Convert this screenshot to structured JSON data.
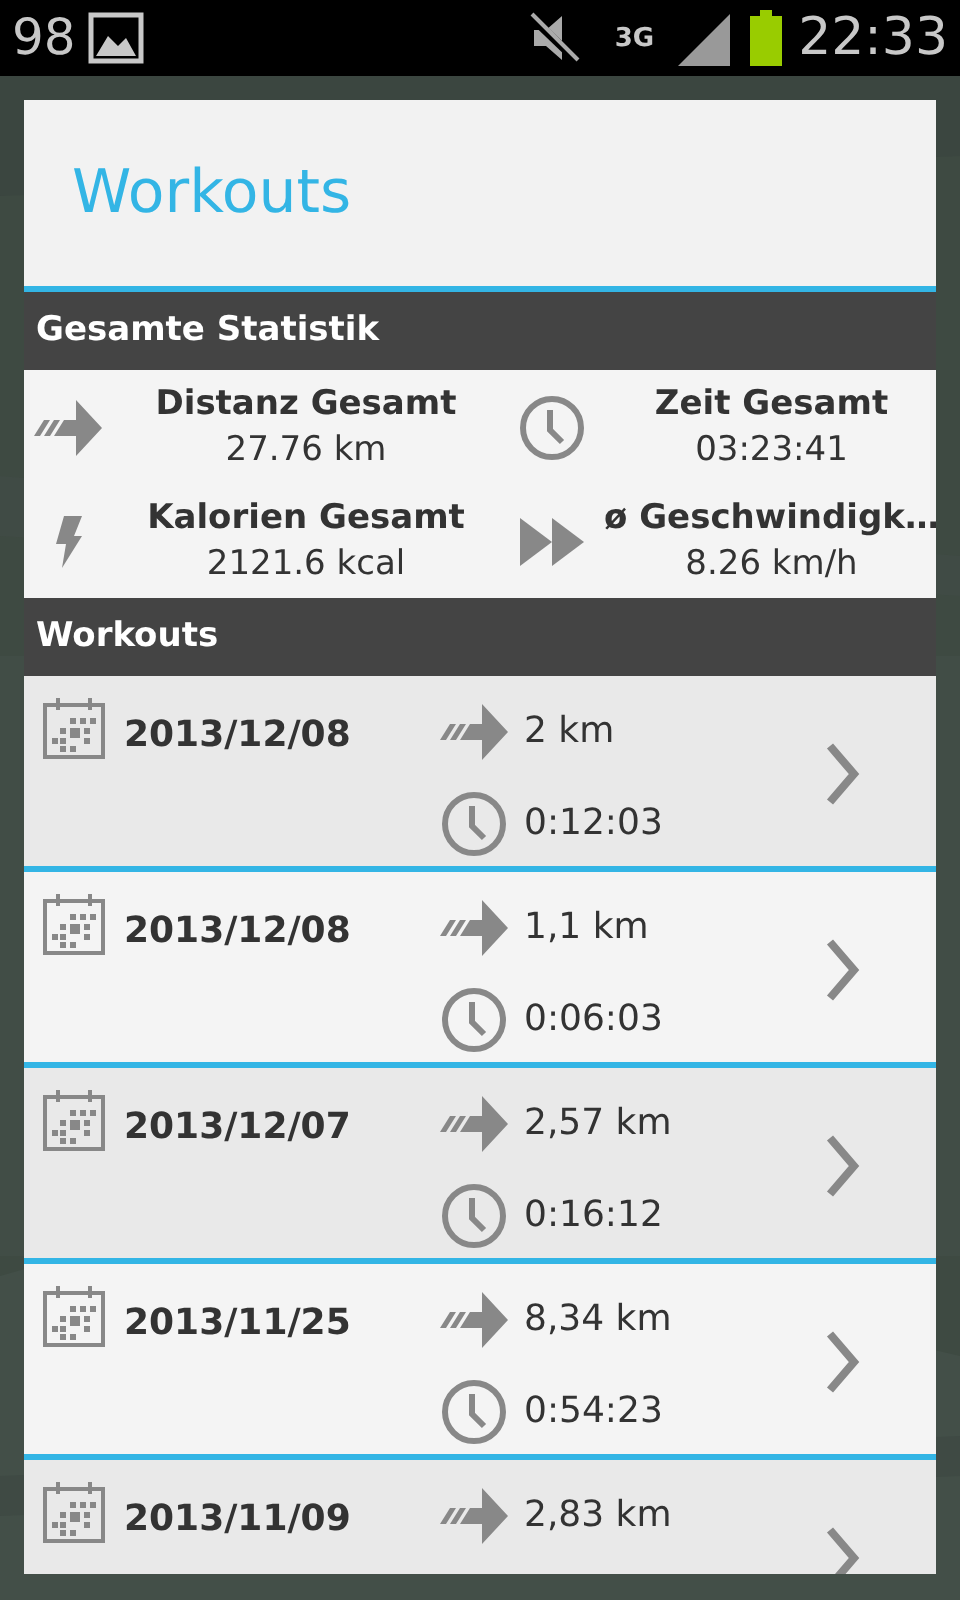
{
  "status_bar": {
    "notification_count": "98",
    "network": "3G",
    "time": "22:33"
  },
  "dialog": {
    "title": "Workouts"
  },
  "summary": {
    "header": "Gesamte Statistik",
    "stats": [
      {
        "kind": "distance",
        "label": "Distanz Gesamt",
        "value": "27.76 km"
      },
      {
        "kind": "time",
        "label": "Zeit Gesamt",
        "value": "03:23:41"
      },
      {
        "kind": "calories",
        "label": "Kalorien Gesamt",
        "value": "2121.6 kcal"
      },
      {
        "kind": "speed",
        "label": "ø Geschwindigk…",
        "value": "8.26 km/h"
      }
    ]
  },
  "workouts": {
    "header": "Workouts",
    "rows": [
      {
        "date": "2013/12/08",
        "distance": "2 km",
        "time": "0:12:03"
      },
      {
        "date": "2013/12/08",
        "distance": "1,1 km",
        "time": "0:06:03"
      },
      {
        "date": "2013/12/07",
        "distance": "2,57 km",
        "time": "0:16:12"
      },
      {
        "date": "2013/11/25",
        "distance": "8,34 km",
        "time": "0:54:23"
      },
      {
        "date": "2013/11/09",
        "distance": "2,83 km"
      }
    ]
  }
}
